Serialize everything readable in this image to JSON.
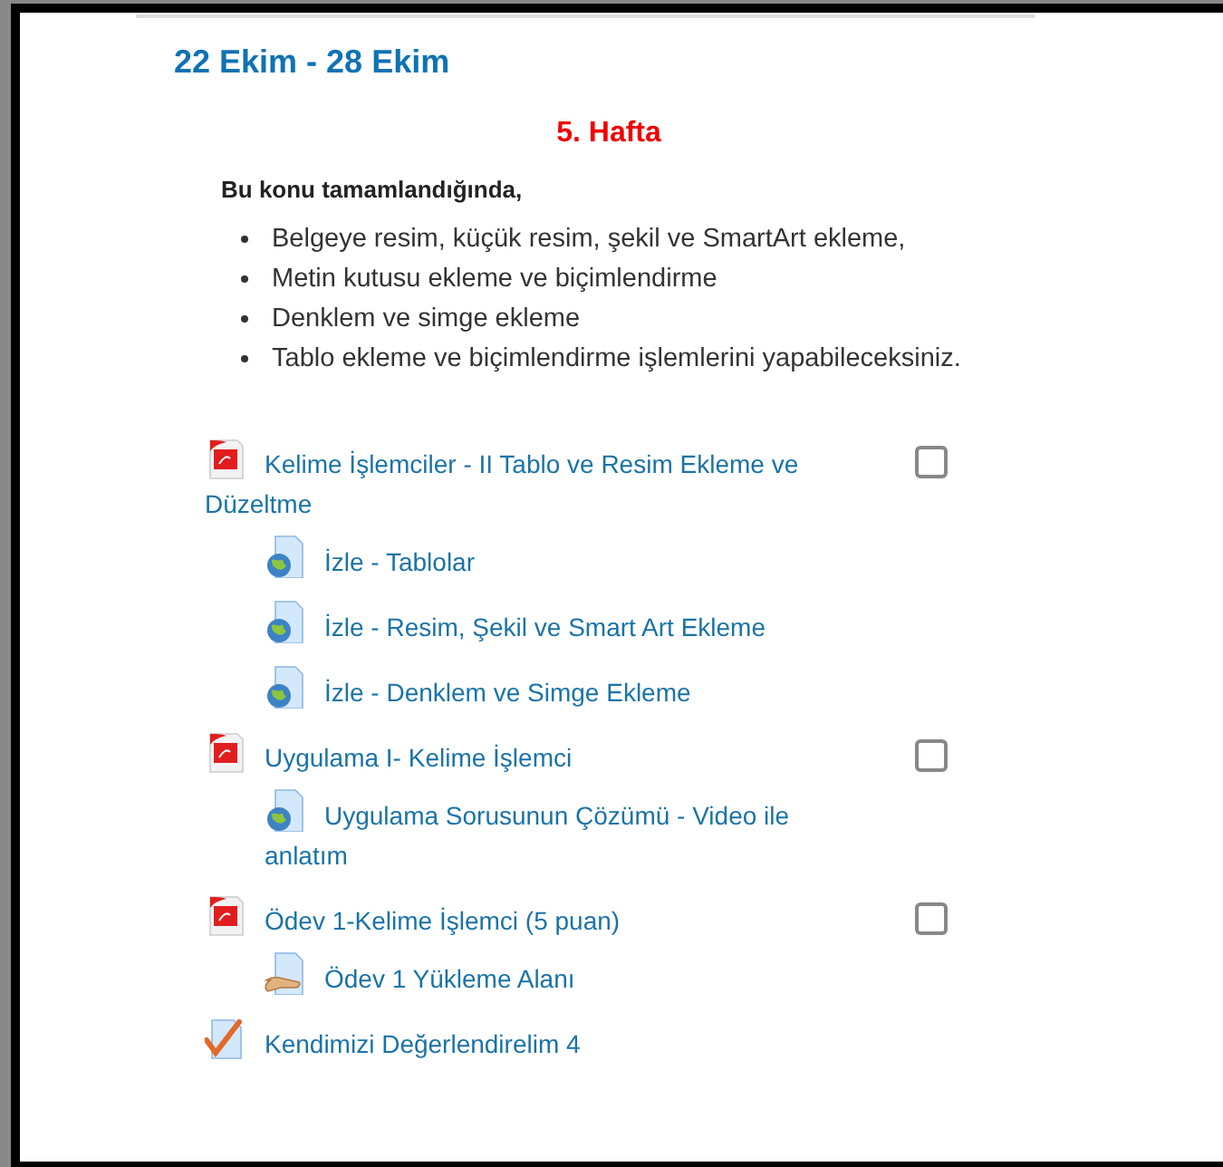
{
  "section": {
    "title": "22 Ekim - 28 Ekim",
    "week": "5. Hafta",
    "intro": "Bu konu tamamlandığında,",
    "bullets": [
      "Belgeye resim, küçük resim, şekil ve SmartArt ekleme,",
      "Metin kutusu ekleme ve biçimlendirme",
      "Denklem ve simge ekleme",
      "Tablo ekleme ve biçimlendirme işlemlerini yapabileceksiniz."
    ]
  },
  "activities": [
    {
      "kind": "pdf",
      "title": "Kelime İşlemciler - II Tablo ve Resim Ekleme ve Düzeltme",
      "checkbox": {
        "checked": false
      },
      "children": [
        {
          "kind": "url",
          "title": "İzle - Tablolar"
        },
        {
          "kind": "url",
          "title": "İzle - Resim, Şekil ve Smart Art Ekleme"
        },
        {
          "kind": "url",
          "title": "İzle - Denklem ve Simge Ekleme"
        }
      ]
    },
    {
      "kind": "pdf",
      "title": "Uygulama I- Kelime İşlemci",
      "checkbox": {
        "checked": false
      },
      "children": [
        {
          "kind": "url",
          "title": "Uygulama Sorusunun Çözümü - Video ile anlatım"
        }
      ]
    },
    {
      "kind": "pdf",
      "title": "Ödev 1-Kelime İşlemci (5 puan)",
      "checkbox": {
        "checked": false
      },
      "children": [
        {
          "kind": "assign",
          "title": "Ödev 1 Yükleme Alanı"
        }
      ]
    },
    {
      "kind": "quiz",
      "title": "Kendimizi Değerlendirelim 4"
    }
  ]
}
